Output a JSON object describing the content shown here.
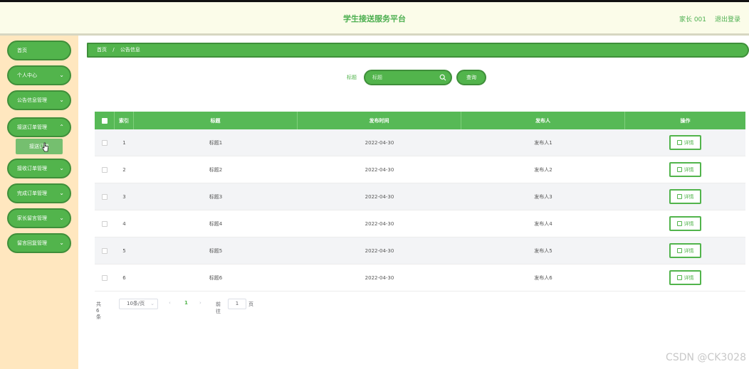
{
  "header": {
    "title": "学生接送服务平台",
    "user": "家长 001",
    "logout": "退出登录"
  },
  "sidebar": {
    "items": [
      {
        "label": "首页",
        "expandable": false
      },
      {
        "label": "个人中心",
        "expandable": true
      },
      {
        "label": "公告信息管理",
        "expandable": true
      },
      {
        "label": "接送订单管理",
        "expandable": true
      },
      {
        "label": "接收订单管理",
        "expandable": true
      },
      {
        "label": "完成订单管理",
        "expandable": true
      },
      {
        "label": "家长留言管理",
        "expandable": true
      },
      {
        "label": "留言回复管理",
        "expandable": true
      }
    ],
    "sub_item": "接送订单"
  },
  "breadcrumb": {
    "home": "首页",
    "separator": "/",
    "current": "公告信息"
  },
  "search": {
    "label": "标题",
    "placeholder": "标题",
    "button": "查询"
  },
  "table": {
    "columns": [
      "索引",
      "标题",
      "发布时间",
      "发布人",
      "操作"
    ],
    "rows": [
      {
        "index": "1",
        "title": "标题1",
        "date": "2022-04-30",
        "author": "发布人1",
        "action": "详情"
      },
      {
        "index": "2",
        "title": "标题2",
        "date": "2022-04-30",
        "author": "发布人2",
        "action": "详情"
      },
      {
        "index": "3",
        "title": "标题3",
        "date": "2022-04-30",
        "author": "发布人3",
        "action": "详情"
      },
      {
        "index": "4",
        "title": "标题4",
        "date": "2022-04-30",
        "author": "发布人4",
        "action": "详情"
      },
      {
        "index": "5",
        "title": "标题5",
        "date": "2022-04-30",
        "author": "发布人5",
        "action": "详情"
      },
      {
        "index": "6",
        "title": "标题6",
        "date": "2022-04-30",
        "author": "发布人6",
        "action": "详情"
      }
    ]
  },
  "pagination": {
    "total": "共 6 条",
    "page_size": "10条/页",
    "prev": "‹",
    "current_page": "1",
    "next": "›",
    "goto_label": "前往",
    "goto_value": "1",
    "page_unit": "页"
  },
  "watermark": "CSDN @CK3028",
  "colors": {
    "accent": "#52b44c",
    "accent_dark": "#3f8f3a",
    "header_bg": "#fbfce9",
    "sidebar_bg": "#ffe7bf"
  }
}
